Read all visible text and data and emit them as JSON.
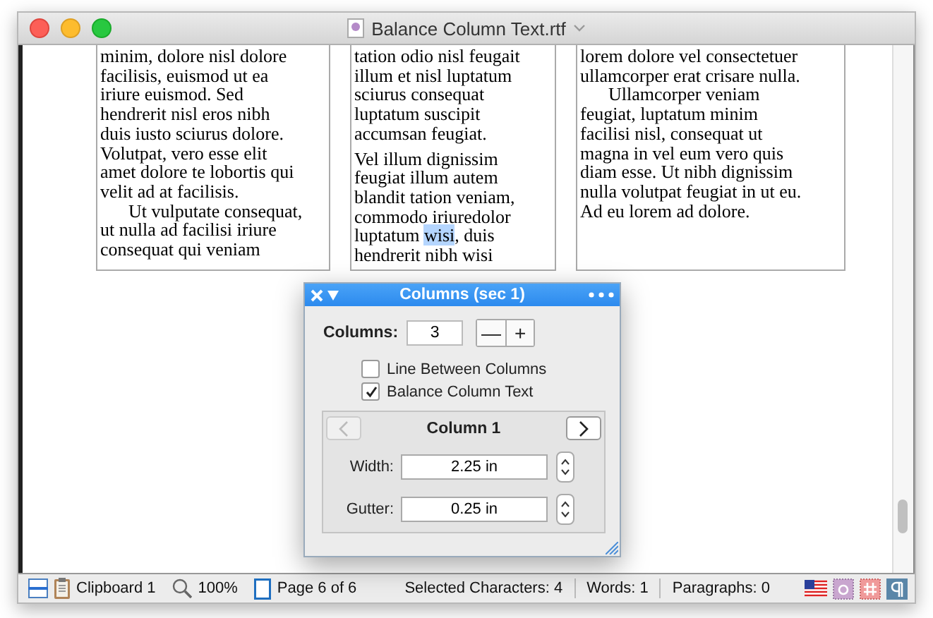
{
  "window": {
    "title": "Balance Column Text.rtf"
  },
  "columns": [
    {
      "paragraphs": [
        {
          "indent": false,
          "lines": [
            "minim, dolore nisl dolore",
            "facilisis, euismod ut ea",
            "iriure euismod. Sed",
            "hendrerit nisl eros nibh",
            "duis iusto sciurus dolore.",
            "Volutpat, vero esse elit",
            "amet dolore te lobortis qui",
            "velit ad at facilisis."
          ]
        },
        {
          "indent": true,
          "lines": [
            "Ut vulputate consequat,",
            "ut nulla ad facilisi iriure",
            "consequat qui veniam"
          ]
        }
      ]
    },
    {
      "paragraphs": [
        {
          "indent": false,
          "lines": [
            "tation odio nisl feugait",
            "illum et nisl luptatum",
            "sciurus consequat",
            "luptatum suscipit",
            "accumsan feugiat."
          ]
        },
        {
          "indent": false,
          "lines": [
            "Vel illum dignissim",
            "feugiat illum autem",
            "blandit tation veniam,",
            "commodo iriuredolor",
            {
              "parts": [
                {
                  "text": "luptatum ",
                  "selected": false
                },
                {
                  "text": "wisi",
                  "selected": true
                },
                {
                  "text": ", duis",
                  "selected": false
                }
              ]
            },
            "hendrerit nibh wisi"
          ]
        }
      ]
    },
    {
      "paragraphs": [
        {
          "indent": false,
          "lines": [
            "lorem dolore vel consectetuer",
            "ullamcorper erat crisare nulla."
          ]
        },
        {
          "indent": true,
          "lines": [
            "Ullamcorper veniam",
            "feugiat, luptatum minim",
            "facilisi nisl, consequat ut",
            "magna in vel eum vero quis",
            "diam esse. Ut nibh dignissim",
            "nulla volutpat feugiat in ut eu.",
            "Ad eu lorem ad dolore."
          ]
        }
      ]
    }
  ],
  "panel": {
    "title": "Columns (sec 1)",
    "columns_label": "Columns:",
    "columns_value": "3",
    "minus": "—",
    "plus": "+",
    "checkboxes": [
      {
        "label": "Line Between Columns",
        "checked": false
      },
      {
        "label": "Balance Column Text",
        "checked": true
      }
    ],
    "column_nav": {
      "title": "Column 1",
      "prev_disabled": true,
      "next_disabled": false
    },
    "fields": [
      {
        "label": "Width:",
        "value": "2.25 in"
      },
      {
        "label": "Gutter:",
        "value": "0.25 in"
      }
    ]
  },
  "status_bar": {
    "clipboard": "Clipboard 1",
    "zoom": "100%",
    "page": "Page 6 of 6",
    "selected_chars": "Selected Characters: 4",
    "words": "Words: 1",
    "paragraphs": "Paragraphs: 0"
  }
}
